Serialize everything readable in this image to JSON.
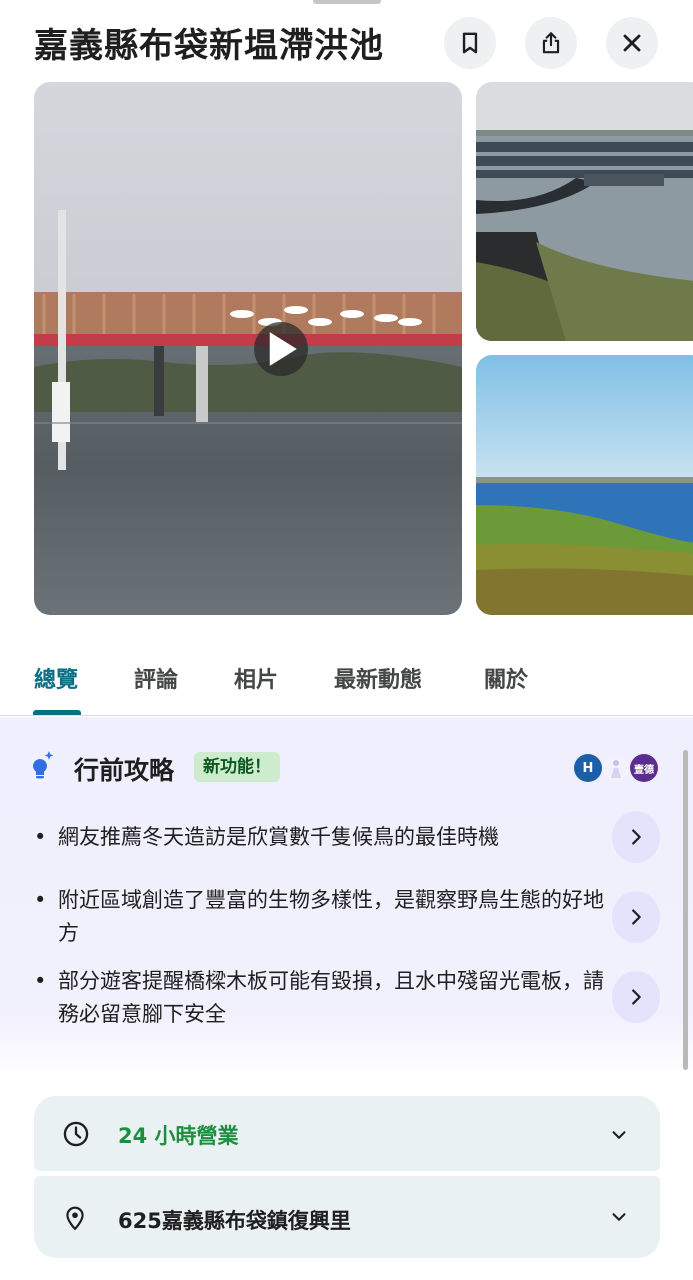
{
  "header": {
    "title": "嘉義縣布袋新塭滯洪池",
    "save_icon": "bookmark-icon",
    "share_icon": "share-icon",
    "close_icon": "close-icon"
  },
  "photos": {
    "main_video": {
      "kind": "video",
      "play_icon": "play-icon"
    },
    "thumbnails": [
      "solar-panels-photo",
      "wetland-photo"
    ]
  },
  "tabs": [
    {
      "label": "總覽",
      "active": true
    },
    {
      "label": "評論",
      "active": false
    },
    {
      "label": "相片",
      "active": false
    },
    {
      "label": "最新動態",
      "active": false
    },
    {
      "label": "關於",
      "active": false
    }
  ],
  "guide": {
    "title": "行前攻略",
    "badge": "新功能！",
    "avatars": [
      "H",
      "",
      "壹德"
    ],
    "tips": [
      {
        "text": "網友推薦冬天造訪是欣賞數千隻候鳥的最佳時機"
      },
      {
        "text": "附近區域創造了豐富的生物多樣性，是觀察野鳥生態的好地方"
      },
      {
        "text": "部分遊客提醒橋樑木板可能有毀損，且水中殘留光電板，請務必留意腳下安全"
      }
    ]
  },
  "info": {
    "hours": "24 小時營業",
    "address": "625嘉義縣布袋鎮復興里"
  },
  "colors": {
    "accent": "#0b6e85",
    "open_green": "#1e8e3e",
    "badge_bg": "#cdeccd",
    "guide_bg": "#f0effd"
  }
}
